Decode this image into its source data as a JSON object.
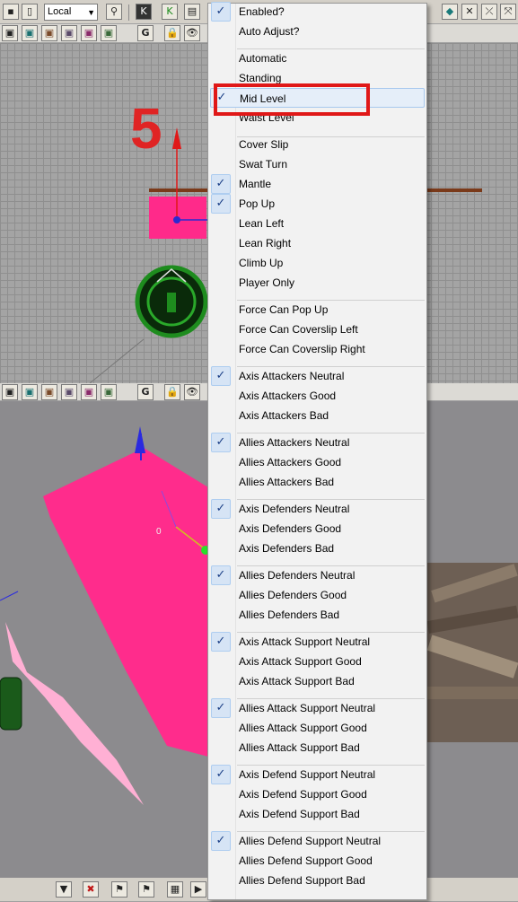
{
  "annotation": {
    "step_number": "5"
  },
  "toolbar": {
    "coord_space": "Local"
  },
  "menu": {
    "items": [
      {
        "label": "Enabled?",
        "checked": true
      },
      {
        "label": "Auto Adjust?",
        "checked": false
      },
      {
        "label": "Automatic",
        "checked": false
      },
      {
        "label": "Standing",
        "checked": false
      },
      {
        "label": "Mid Level",
        "checked": true,
        "highlighted": true
      },
      {
        "label": "Waist Level",
        "checked": false
      },
      {
        "label": "Cover Slip",
        "checked": false
      },
      {
        "label": "Swat Turn",
        "checked": false
      },
      {
        "label": "Mantle",
        "checked": true
      },
      {
        "label": "Pop Up",
        "checked": true
      },
      {
        "label": "Lean Left",
        "checked": false
      },
      {
        "label": "Lean Right",
        "checked": false
      },
      {
        "label": "Climb Up",
        "checked": false
      },
      {
        "label": "Player Only",
        "checked": false
      },
      {
        "label": "Force Can Pop Up",
        "checked": false
      },
      {
        "label": "Force Can Coverslip Left",
        "checked": false
      },
      {
        "label": "Force Can Coverslip Right",
        "checked": false
      },
      {
        "label": "Axis Attackers Neutral",
        "checked": true
      },
      {
        "label": "Axis Attackers Good",
        "checked": false
      },
      {
        "label": "Axis Attackers Bad",
        "checked": false
      },
      {
        "label": "Allies Attackers Neutral",
        "checked": true
      },
      {
        "label": "Allies Attackers Good",
        "checked": false
      },
      {
        "label": "Allies Attackers Bad",
        "checked": false
      },
      {
        "label": "Axis Defenders Neutral",
        "checked": true
      },
      {
        "label": "Axis Defenders Good",
        "checked": false
      },
      {
        "label": "Axis Defenders Bad",
        "checked": false
      },
      {
        "label": "Allies Defenders Neutral",
        "checked": true
      },
      {
        "label": "Allies Defenders Good",
        "checked": false
      },
      {
        "label": "Allies Defenders Bad",
        "checked": false
      },
      {
        "label": "Axis Attack Support Neutral",
        "checked": true
      },
      {
        "label": "Axis Attack Support Good",
        "checked": false
      },
      {
        "label": "Axis Attack Support Bad",
        "checked": false
      },
      {
        "label": "Allies Attack Support Neutral",
        "checked": true
      },
      {
        "label": "Allies Attack Support Good",
        "checked": false
      },
      {
        "label": "Allies Attack Support Bad",
        "checked": false
      },
      {
        "label": "Axis Defend Support Neutral",
        "checked": true
      },
      {
        "label": "Axis Defend Support Good",
        "checked": false
      },
      {
        "label": "Axis Defend Support Bad",
        "checked": false
      },
      {
        "label": "Allies Defend Support Neutral",
        "checked": true
      },
      {
        "label": "Allies Defend Support Good",
        "checked": false
      },
      {
        "label": "Allies Defend Support Bad",
        "checked": false
      }
    ]
  }
}
